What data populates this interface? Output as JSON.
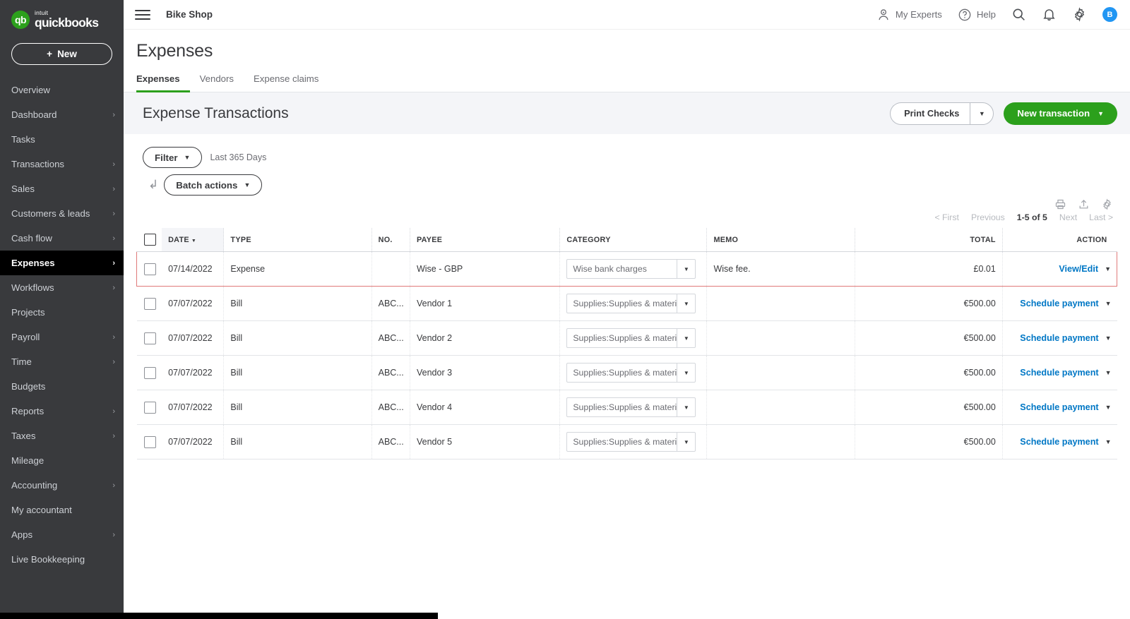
{
  "brand": {
    "intuit": "intuit",
    "name": "quickbooks",
    "mark": "qb"
  },
  "sidebar": {
    "new_button": "New",
    "plus": "+",
    "items": [
      {
        "label": "Overview",
        "chevron": "",
        "active": false
      },
      {
        "label": "Dashboard",
        "chevron": "›",
        "active": false
      },
      {
        "label": "Tasks",
        "chevron": "",
        "active": false
      },
      {
        "label": "Transactions",
        "chevron": "›",
        "active": false
      },
      {
        "label": "Sales",
        "chevron": "›",
        "active": false
      },
      {
        "label": "Customers & leads",
        "chevron": "›",
        "active": false
      },
      {
        "label": "Cash flow",
        "chevron": "›",
        "active": false
      },
      {
        "label": "Expenses",
        "chevron": "›",
        "active": true
      },
      {
        "label": "Workflows",
        "chevron": "›",
        "active": false
      },
      {
        "label": "Projects",
        "chevron": "",
        "active": false
      },
      {
        "label": "Payroll",
        "chevron": "›",
        "active": false
      },
      {
        "label": "Time",
        "chevron": "›",
        "active": false
      },
      {
        "label": "Budgets",
        "chevron": "",
        "active": false
      },
      {
        "label": "Reports",
        "chevron": "›",
        "active": false
      },
      {
        "label": "Taxes",
        "chevron": "›",
        "active": false
      },
      {
        "label": "Mileage",
        "chevron": "",
        "active": false
      },
      {
        "label": "Accounting",
        "chevron": "›",
        "active": false
      },
      {
        "label": "My accountant",
        "chevron": "",
        "active": false
      },
      {
        "label": "Apps",
        "chevron": "›",
        "active": false
      },
      {
        "label": "Live Bookkeeping",
        "chevron": "",
        "active": false
      }
    ]
  },
  "topbar": {
    "company": "Bike Shop",
    "my_experts": "My Experts",
    "help": "Help",
    "avatar_initial": "B",
    "icons": [
      "hamburger-icon",
      "experts-icon",
      "help-icon",
      "search-icon",
      "bell-icon",
      "gear-icon"
    ]
  },
  "page": {
    "title": "Expenses",
    "tabs": [
      {
        "label": "Expenses",
        "active": true
      },
      {
        "label": "Vendors",
        "active": false
      },
      {
        "label": "Expense claims",
        "active": false
      }
    ]
  },
  "subheader": {
    "heading": "Expense Transactions",
    "print_checks": "Print Checks",
    "new_transaction": "New transaction"
  },
  "toolbar": {
    "filter": "Filter",
    "date_range": "Last 365 Days",
    "batch_actions": "Batch actions"
  },
  "pager": {
    "first": "< First",
    "previous": "Previous",
    "range": "1-5 of 5",
    "next": "Next",
    "last": "Last >"
  },
  "table": {
    "columns": [
      "DATE",
      "TYPE",
      "NO.",
      "PAYEE",
      "CATEGORY",
      "MEMO",
      "TOTAL",
      "ACTION"
    ],
    "sort_column": "DATE",
    "rows": [
      {
        "date": "07/14/2022",
        "type": "Expense",
        "no": "",
        "payee": "Wise - GBP",
        "category": "Wise bank charges",
        "memo": "Wise fee.",
        "total": "£0.01",
        "action": "View/Edit",
        "highlighted": true
      },
      {
        "date": "07/07/2022",
        "type": "Bill",
        "no": "ABC...",
        "payee": "Vendor 1",
        "category": "Supplies:Supplies & materią",
        "memo": "",
        "total": "€500.00",
        "action": "Schedule payment",
        "highlighted": false
      },
      {
        "date": "07/07/2022",
        "type": "Bill",
        "no": "ABC...",
        "payee": "Vendor 2",
        "category": "Supplies:Supplies & materią",
        "memo": "",
        "total": "€500.00",
        "action": "Schedule payment",
        "highlighted": false
      },
      {
        "date": "07/07/2022",
        "type": "Bill",
        "no": "ABC...",
        "payee": "Vendor 3",
        "category": "Supplies:Supplies & materią",
        "memo": "",
        "total": "€500.00",
        "action": "Schedule payment",
        "highlighted": false
      },
      {
        "date": "07/07/2022",
        "type": "Bill",
        "no": "ABC...",
        "payee": "Vendor 4",
        "category": "Supplies:Supplies & materią",
        "memo": "",
        "total": "€500.00",
        "action": "Schedule payment",
        "highlighted": false
      },
      {
        "date": "07/07/2022",
        "type": "Bill",
        "no": "ABC...",
        "payee": "Vendor 5",
        "category": "Supplies:Supplies & materią",
        "memo": "",
        "total": "€500.00",
        "action": "Schedule payment",
        "highlighted": false
      }
    ]
  },
  "colors": {
    "sidebar_bg": "#393a3d",
    "accent_green": "#2ca01c",
    "link_blue": "#0077c5",
    "highlight_border": "#e07a7a",
    "avatar_blue": "#2196f3"
  }
}
